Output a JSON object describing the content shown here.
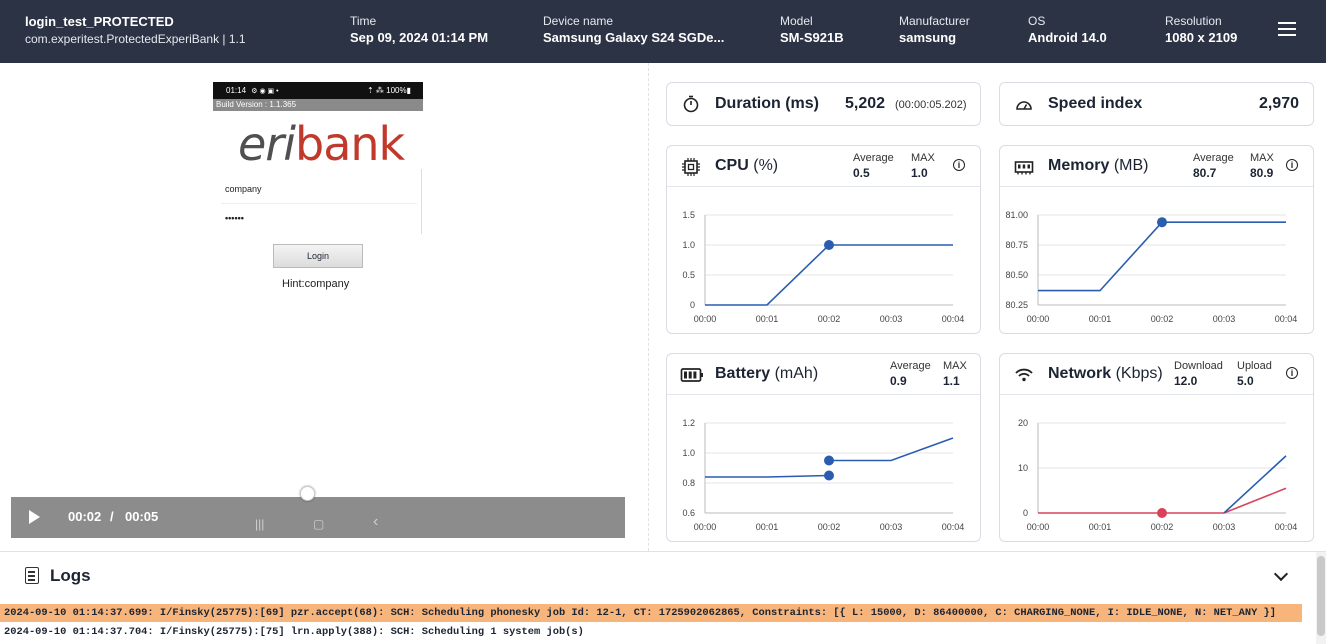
{
  "header": {
    "test_name": "login_test_PROTECTED",
    "app_id": "com.experitest.ProtectedExperiBank | 1.1",
    "columns": [
      {
        "label": "Time",
        "value": "Sep 09, 2024 01:14 PM"
      },
      {
        "label": "Device name",
        "value": "Samsung Galaxy S24 SGDe..."
      },
      {
        "label": "Model",
        "value": "SM-S921B"
      },
      {
        "label": "Manufacturer",
        "value": "samsung"
      },
      {
        "label": "OS",
        "value": "Android 14.0"
      },
      {
        "label": "Resolution",
        "value": "1080 x 2109"
      }
    ],
    "menu_icon": "hamburger-menu-icon"
  },
  "device_screen": {
    "status_time": "01:14",
    "status_icons": "⚙ ◉ ▣ •",
    "status_right": "⇡ ⁂ 100%▮",
    "build_version": "Build Version : 1.1.365",
    "logo_part1": "eri",
    "logo_part2": "bank",
    "username": "company",
    "password_mask": "••••••",
    "login_button": "Login",
    "hint": "Hint:company"
  },
  "player": {
    "current_time": "00:02",
    "separator": "/",
    "total_time": "00:05",
    "progress_fraction": 0.4,
    "nav_recent": "|||",
    "nav_home": "▢",
    "nav_back": "‹"
  },
  "metrics": {
    "duration": {
      "label": "Duration (ms)",
      "value": "5,202",
      "note": "(00:00:05.202)"
    },
    "speed_index": {
      "label": "Speed index",
      "value": "2,970"
    },
    "cpu": {
      "title": "CPU",
      "unit": "(%)",
      "stat1_label": "Average",
      "stat1_value": "0.5",
      "stat2_label": "MAX",
      "stat2_value": "1.0"
    },
    "memory": {
      "title": "Memory",
      "unit": "(MB)",
      "stat1_label": "Average",
      "stat1_value": "80.7",
      "stat2_label": "MAX",
      "stat2_value": "80.9"
    },
    "battery": {
      "title": "Battery",
      "unit": "(mAh)",
      "stat1_label": "Average",
      "stat1_value": "0.9",
      "stat2_label": "MAX",
      "stat2_value": "1.1"
    },
    "network": {
      "title": "Network",
      "unit": "(Kbps)",
      "stat1_label": "Download",
      "stat1_value": "12.0",
      "stat2_label": "Upload",
      "stat2_value": "5.0"
    },
    "info_icon": "i"
  },
  "chart_data": [
    {
      "id": "cpu",
      "type": "line",
      "x": [
        "00:00",
        "00:01",
        "00:02",
        "00:03",
        "00:04"
      ],
      "y_ticks": [
        "1.5",
        "1.0",
        "0.5",
        "0"
      ],
      "ylim": [
        0,
        1.5
      ],
      "series": [
        {
          "color": "#2a5db0",
          "points": [
            [
              0,
              0
            ],
            [
              1,
              0
            ],
            [
              2,
              1.0
            ],
            [
              3,
              1.0
            ],
            [
              4,
              1.0
            ]
          ]
        }
      ],
      "markers": [
        {
          "x": 2,
          "y": 1.0,
          "color": "#2a5db0"
        }
      ],
      "grid": true
    },
    {
      "id": "memory",
      "type": "line",
      "x": [
        "00:00",
        "00:01",
        "00:02",
        "00:03",
        "00:04"
      ],
      "y_ticks": [
        "81.00",
        "80.75",
        "80.50",
        "80.25"
      ],
      "ylim": [
        80.25,
        81.0
      ],
      "series": [
        {
          "color": "#2a5db0",
          "points": [
            [
              0,
              80.37
            ],
            [
              1,
              80.37
            ],
            [
              2,
              80.94
            ],
            [
              3,
              80.94
            ],
            [
              4,
              80.94
            ]
          ]
        }
      ],
      "markers": [
        {
          "x": 2,
          "y": 80.94,
          "color": "#2a5db0"
        }
      ],
      "grid": true
    },
    {
      "id": "battery",
      "type": "line",
      "x": [
        "00:00",
        "00:01",
        "00:02",
        "00:03",
        "00:04"
      ],
      "y_ticks": [
        "1.2",
        "1.0",
        "0.8",
        "0.6"
      ],
      "ylim": [
        0.6,
        1.2
      ],
      "series": [
        {
          "color": "#2a5db0",
          "points": [
            [
              0,
              0.84
            ],
            [
              1,
              0.84
            ],
            [
              2,
              0.85
            ]
          ]
        },
        {
          "color": "#2a5db0",
          "points": [
            [
              2,
              0.95
            ],
            [
              3,
              0.95
            ],
            [
              4,
              1.1
            ]
          ]
        }
      ],
      "markers": [
        {
          "x": 2,
          "y": 0.95,
          "color": "#2a5db0"
        },
        {
          "x": 2,
          "y": 0.85,
          "color": "#2a5db0"
        }
      ],
      "grid": true
    },
    {
      "id": "network",
      "type": "line",
      "x": [
        "00:00",
        "00:01",
        "00:02",
        "00:03",
        "00:04"
      ],
      "y_ticks": [
        "20",
        "10",
        "0"
      ],
      "ylim": [
        0,
        20
      ],
      "series": [
        {
          "color": "#d9435a",
          "points": [
            [
              0,
              0
            ],
            [
              1,
              0
            ],
            [
              2,
              0
            ],
            [
              3,
              0
            ],
            [
              4,
              5.5
            ]
          ]
        },
        {
          "color": "#2a5db0",
          "points": [
            [
              3,
              0
            ],
            [
              4,
              12.7
            ]
          ]
        }
      ],
      "markers": [
        {
          "x": 2,
          "y": 0,
          "color": "#d9435a"
        }
      ],
      "grid": true
    }
  ],
  "logs": {
    "title": "Logs",
    "lines": [
      "2024-09-10 01:14:37.699: I/Finsky(25775):[69] pzr.accept(68): SCH: Scheduling phonesky job Id: 12-1, CT: 1725902062865, Constraints: [{ L: 15000, D: 86400000, C: CHARGING_NONE, I: IDLE_NONE, N: NET_ANY }]",
      "2024-09-10 01:14:37.704: I/Finsky(25775):[75] lrn.apply(388): SCH: Scheduling 1 system job(s)"
    ]
  }
}
